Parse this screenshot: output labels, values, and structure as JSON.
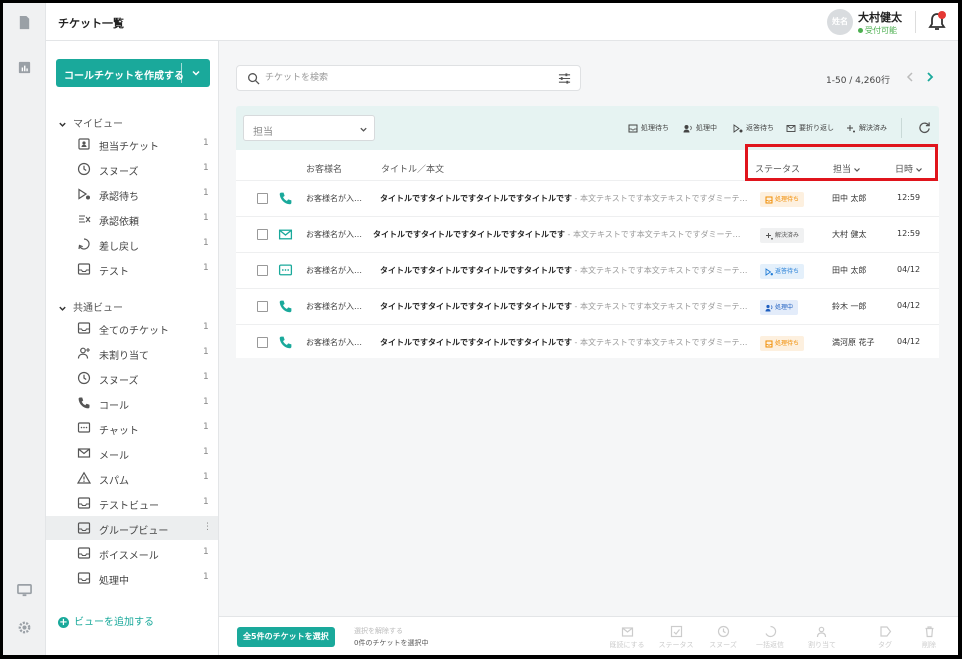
{
  "header": {
    "title": "チケット一覧",
    "avatar_text": "姓名",
    "user_name": "大村健太",
    "user_status": "受付可能"
  },
  "sidebar": {
    "create_button": "コールチケットを作成する",
    "my_view_title": "マイビュー",
    "my_view_items": [
      {
        "label": "担当チケット",
        "count": "1",
        "icon": "assigned-icon"
      },
      {
        "label": "スヌーズ",
        "count": "1",
        "icon": "clock-icon"
      },
      {
        "label": "承認待ち",
        "count": "1",
        "icon": "approval-icon"
      },
      {
        "label": "承認依頼",
        "count": "1",
        "icon": "request-icon"
      },
      {
        "label": "差し戻し",
        "count": "1",
        "icon": "return-icon"
      },
      {
        "label": "テスト",
        "count": "1",
        "icon": "inbox-icon"
      }
    ],
    "shared_view_title": "共通ビュー",
    "shared_view_items": [
      {
        "label": "全てのチケット",
        "count": "1",
        "icon": "inbox-icon"
      },
      {
        "label": "未割り当て",
        "count": "1",
        "icon": "user-add-icon"
      },
      {
        "label": "スヌーズ",
        "count": "1",
        "icon": "clock-icon"
      },
      {
        "label": "コール",
        "count": "1",
        "icon": "phone-icon"
      },
      {
        "label": "チャット",
        "count": "1",
        "icon": "chat-icon"
      },
      {
        "label": "メール",
        "count": "1",
        "icon": "mail-icon"
      },
      {
        "label": "スパム",
        "count": "1",
        "icon": "warning-icon"
      },
      {
        "label": "テストビュー",
        "count": "1",
        "icon": "inbox-icon"
      },
      {
        "label": "グループビュー",
        "count": "⋮",
        "icon": "inbox-icon"
      },
      {
        "label": "ボイスメール",
        "count": "1",
        "icon": "inbox-icon"
      },
      {
        "label": "処理中",
        "count": "1",
        "icon": "inbox-icon"
      }
    ],
    "add_view": "ビューを追加する"
  },
  "search": {
    "placeholder": "チケットを検索"
  },
  "pager": {
    "range": "1-50 / 4,260行"
  },
  "toolbar": {
    "assignee_select": "担当",
    "actions": [
      "処理待ち",
      "処理中",
      "返答待ち",
      "要折り返し",
      "解決済み"
    ]
  },
  "table": {
    "headers": {
      "customer": "お客様名",
      "subject": "タイトル／本文",
      "status": "ステータス",
      "assignee": "担当",
      "time": "日時"
    },
    "rows": [
      {
        "channel": "phone-icon",
        "customer": "お客様名が入…",
        "subject": "タイトルですタイトルですタイトルですタイトルです",
        "body": " - 本文テキストです本文テキストですダミーテ…",
        "status": "処理待ち",
        "status_color": "#f08c00",
        "status_bg": "#fdf0df",
        "assignee": "田中 太郎",
        "time": "12:59"
      },
      {
        "channel": "mail-icon",
        "customer": "お客様名が入…",
        "subject": "タイトルですタイトルですタイトルですタイトルです",
        "body": " - 本文テキストです本文テキストですダミーテ…",
        "status": "解決済み",
        "status_color": "#555555",
        "status_bg": "#f0f1f2",
        "assignee": "大村 健太",
        "time": "12:59"
      },
      {
        "channel": "chat-icon",
        "customer": "お客様名が入…",
        "subject": "タイトルですタイトルですタイトルですタイトルです",
        "body": " - 本文テキストです本文テキストですダミーテ…",
        "status": "返答待ち",
        "status_color": "#1f7bd6",
        "status_bg": "#e4f0fb",
        "assignee": "田中 太郎",
        "time": "04/12"
      },
      {
        "channel": "phone-icon",
        "customer": "お客様名が入…",
        "subject": "タイトルですタイトルですタイトルですタイトルです",
        "body": " - 本文テキストです本文テキストですダミーテ…",
        "status": "処理中",
        "status_color": "#1f5fc0",
        "status_bg": "#e3ecfa",
        "assignee": "鈴木 一郎",
        "time": "04/12"
      },
      {
        "channel": "phone-icon",
        "customer": "お客様名が入…",
        "subject": "タイトルですタイトルですタイトルですタイトルです",
        "body": " - 本文テキストです本文テキストですダミーテ…",
        "status": "処理待ち",
        "status_color": "#f08c00",
        "status_bg": "#fdf0df",
        "assignee": "満河原 花子",
        "time": "04/12"
      }
    ]
  },
  "bottom": {
    "select_all": "全5件のチケットを選択",
    "deselect": "選択を解除する",
    "selected_count": "0件のチケットを選択中",
    "bulk_actions": [
      "既読にする",
      "ステータス",
      "スヌーズ",
      "一括返信",
      "割り当て",
      "タグ",
      "削除"
    ]
  },
  "colors": {
    "accent": "#1aa99b",
    "highlight": "#e0141c"
  }
}
